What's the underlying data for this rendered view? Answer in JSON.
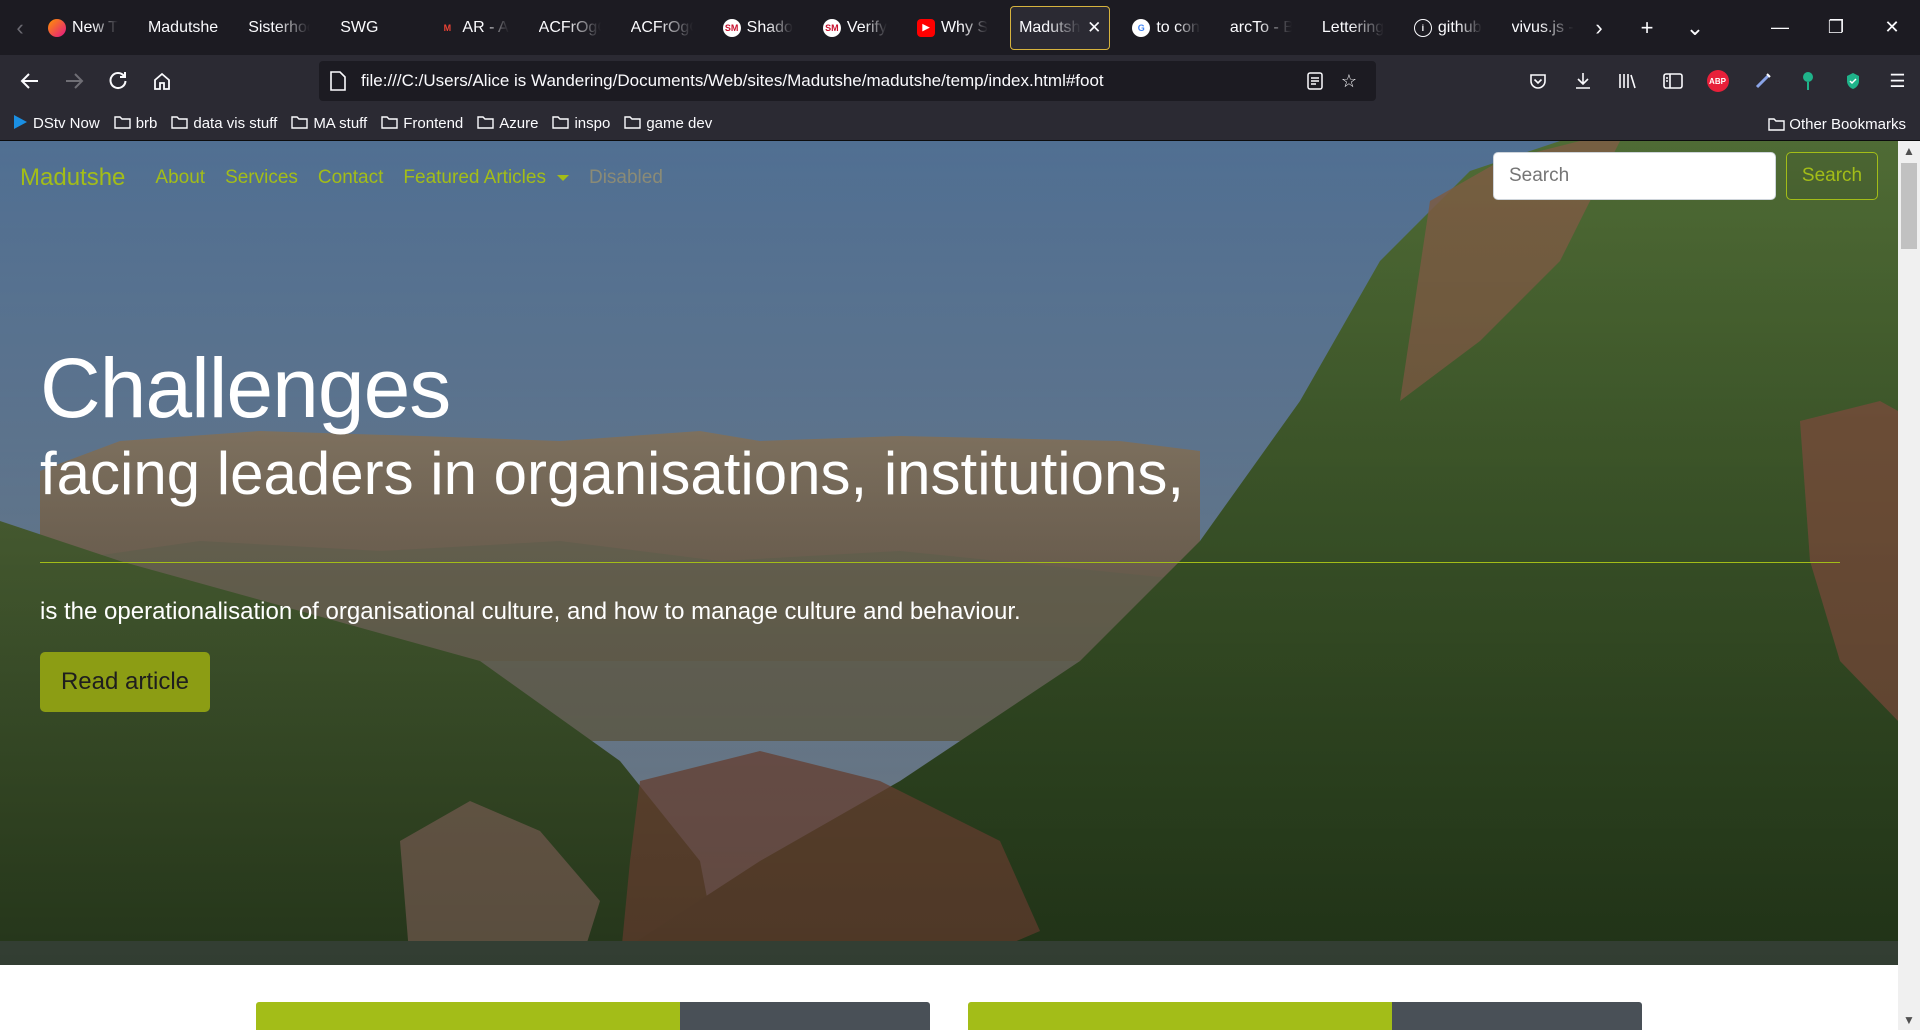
{
  "browser": {
    "tabs": [
      {
        "label": "New T",
        "favicon": "firefox-icon",
        "fade": true
      },
      {
        "label": "Madutshe",
        "favicon": "",
        "fade": false
      },
      {
        "label": "Sisterhood",
        "favicon": "",
        "fade": true
      },
      {
        "label": "SWG",
        "favicon": "",
        "fade": false
      },
      {
        "label": "",
        "favicon": "",
        "fade": false
      },
      {
        "label": "AR - A",
        "favicon": "gmail-icon",
        "fade": true
      },
      {
        "label": "ACFrOgCg",
        "favicon": "",
        "fade": true
      },
      {
        "label": "ACFrOgCT",
        "favicon": "",
        "fade": true
      },
      {
        "label": "Shado",
        "favicon": "sm-icon",
        "fade": true
      },
      {
        "label": "Verify",
        "favicon": "sm-icon",
        "fade": true
      },
      {
        "label": "Why S",
        "favicon": "youtube-icon",
        "fade": true
      },
      {
        "label": "Madutshe",
        "favicon": "",
        "fade": true,
        "active": true
      },
      {
        "label": "to con",
        "favicon": "google-icon",
        "fade": true
      },
      {
        "label": "arcTo - Bo",
        "favicon": "",
        "fade": true
      },
      {
        "label": "Lettering.j",
        "favicon": "",
        "fade": true
      },
      {
        "label": "github",
        "favicon": "info-icon",
        "fade": true
      },
      {
        "label": "vivus.js - s",
        "favicon": "",
        "fade": true
      }
    ],
    "url": "file:///C:/Users/Alice is Wandering/Documents/Web/sites/Madutshe/madutshe/temp/index.html#foot",
    "bookmarks": [
      {
        "label": "DStv Now",
        "icon": "dstv-icon"
      },
      {
        "label": "brb",
        "icon": "folder-icon"
      },
      {
        "label": "data vis stuff",
        "icon": "folder-icon"
      },
      {
        "label": "MA stuff",
        "icon": "folder-icon"
      },
      {
        "label": "Frontend",
        "icon": "folder-icon"
      },
      {
        "label": "Azure",
        "icon": "folder-icon"
      },
      {
        "label": "inspo",
        "icon": "folder-icon"
      },
      {
        "label": "game dev",
        "icon": "folder-icon"
      }
    ],
    "other_bookmarks": "Other Bookmarks",
    "abp_label": "ABP"
  },
  "site": {
    "brand": "Madutshe",
    "nav": {
      "about": "About",
      "services": "Services",
      "contact": "Contact",
      "featured": "Featured Articles",
      "disabled": "Disabled"
    },
    "search": {
      "placeholder": "Search",
      "button": "Search"
    },
    "hero": {
      "title": "Challenges",
      "subtitle": "facing leaders in organisations, institutions,",
      "lead": "is the operationalisation of organisational culture, and how to manage culture and behaviour.",
      "button": "Read article"
    }
  },
  "colors": {
    "accent": "#a3bd18",
    "button": "#8c9d14",
    "active_tab_border": "#d6b33e",
    "chrome_dark": "#1c1b22",
    "chrome_mid": "#2b2a33"
  }
}
